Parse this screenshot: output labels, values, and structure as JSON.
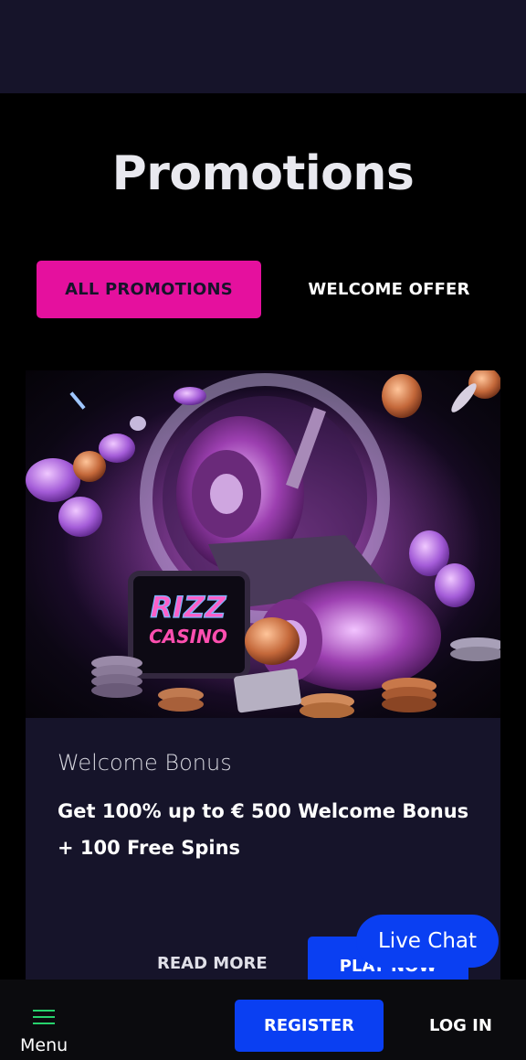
{
  "page": {
    "title": "Promotions"
  },
  "tabs": [
    {
      "label": "ALL PROMOTIONS",
      "active": true
    },
    {
      "label": "WELCOME OFFER",
      "active": false
    }
  ],
  "promo": {
    "label": "Welcome Bonus",
    "description": "Get 100% up to € 500 Welcome Bonus + 100 Free Spins",
    "read_more": "READ MORE",
    "play_now": "PLAY NOW",
    "image_text": [
      "RIZZ",
      "CASINO"
    ]
  },
  "live_chat": {
    "label": "Live Chat"
  },
  "bottom_nav": {
    "menu_label": "Menu",
    "register_label": "REGISTER",
    "login_label": "LOG IN"
  },
  "colors": {
    "accent_pink": "#e5109e",
    "accent_blue": "#0a3ff2",
    "header_bg": "#16142a",
    "menu_icon": "#27d26d"
  }
}
